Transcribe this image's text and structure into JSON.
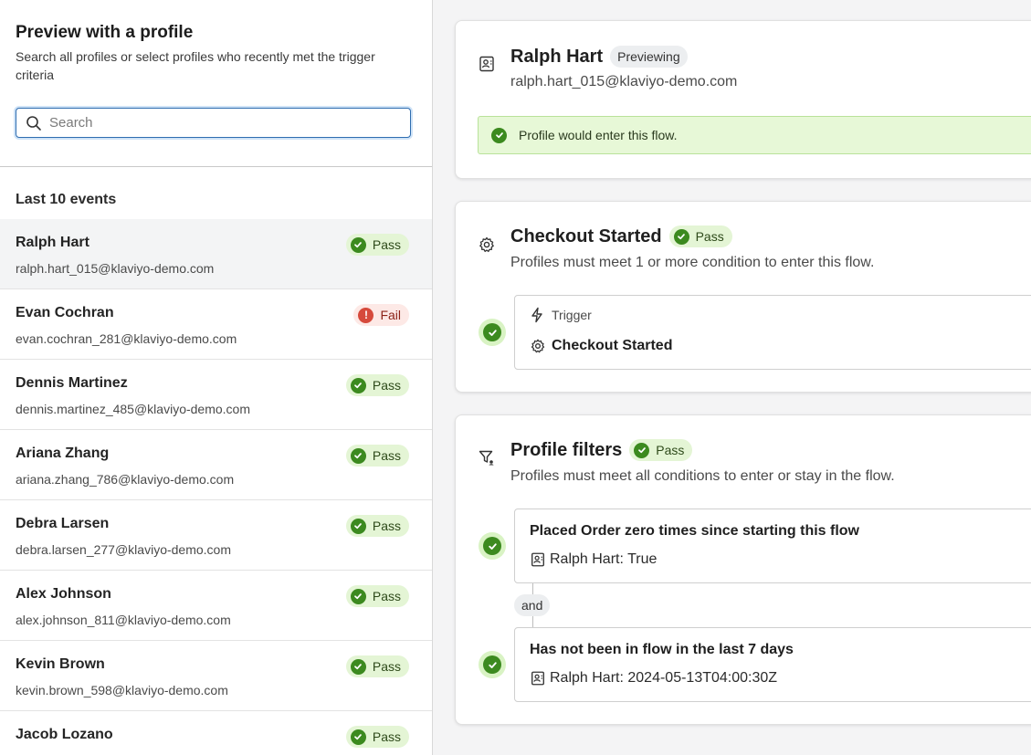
{
  "left": {
    "title": "Preview with a profile",
    "subtitle": "Search all profiles or select profiles who recently met the trigger criteria",
    "search": {
      "placeholder": "Search",
      "value": ""
    },
    "events_title": "Last 10 events",
    "profiles": [
      {
        "name": "Ralph Hart",
        "email": "ralph.hart_015@klaviyo-demo.com",
        "status": "Pass",
        "active": true
      },
      {
        "name": "Evan Cochran",
        "email": "evan.cochran_281@klaviyo-demo.com",
        "status": "Fail"
      },
      {
        "name": "Dennis Martinez",
        "email": "dennis.martinez_485@klaviyo-demo.com",
        "status": "Pass"
      },
      {
        "name": "Ariana Zhang",
        "email": "ariana.zhang_786@klaviyo-demo.com",
        "status": "Pass"
      },
      {
        "name": "Debra Larsen",
        "email": "debra.larsen_277@klaviyo-demo.com",
        "status": "Pass"
      },
      {
        "name": "Alex Johnson",
        "email": "alex.johnson_811@klaviyo-demo.com",
        "status": "Pass"
      },
      {
        "name": "Kevin Brown",
        "email": "kevin.brown_598@klaviyo-demo.com",
        "status": "Pass"
      },
      {
        "name": "Jacob Lozano",
        "email": "",
        "status": "Pass"
      }
    ]
  },
  "profile_card": {
    "name": "Ralph Hart",
    "badge": "Previewing",
    "email": "ralph.hart_015@klaviyo-demo.com",
    "banner": "Profile would enter this flow."
  },
  "trigger_card": {
    "title": "Checkout Started",
    "badge": "Pass",
    "subtitle": "Profiles must meet 1 or more condition to enter this flow.",
    "box_label": "Trigger",
    "box_value": "Checkout Started"
  },
  "filters_card": {
    "title": "Profile filters",
    "badge": "Pass",
    "subtitle": "Profiles must meet all conditions to enter or stay in the flow.",
    "conditions": [
      {
        "title": "Placed Order zero times since starting this flow",
        "detail": "Ralph Hart: True"
      },
      {
        "title": "Has not been in flow in the last 7 days",
        "detail": "Ralph Hart: 2024-05-13T04:00:30Z"
      }
    ],
    "joiner": "and"
  },
  "colors": {
    "pass_green": "#3c8a1f",
    "pass_bg": "#e4f5d5",
    "fail_red": "#d64a3c",
    "fail_bg": "#fde9e6",
    "focus_blue": "#2f6db0"
  }
}
